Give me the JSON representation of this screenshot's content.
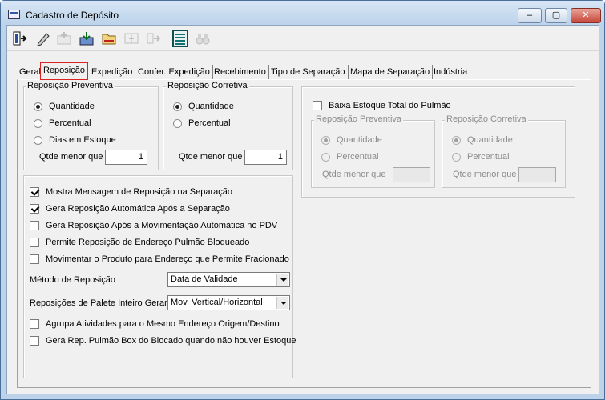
{
  "window": {
    "title": "Cadastro de Depósito",
    "minimize": "–",
    "maximize": "▢",
    "close": "✕"
  },
  "toolbar": {
    "buttons": [
      {
        "icon": "exit-icon",
        "enabled": true
      },
      {
        "icon": "edit-icon",
        "enabled": true
      },
      {
        "icon": "add-icon",
        "enabled": false
      },
      {
        "icon": "save-icon",
        "enabled": true
      },
      {
        "icon": "open-icon",
        "enabled": true
      },
      {
        "icon": "copy-icon",
        "enabled": false
      },
      {
        "icon": "transfer-icon",
        "enabled": false
      },
      {
        "icon": "report-icon",
        "enabled": true
      },
      {
        "icon": "binoculars-icon",
        "enabled": false
      }
    ]
  },
  "tabs": [
    "Geral",
    "Reposição",
    "Expedição",
    "Confer. Expedição",
    "Recebimento",
    "Tipo de Separação",
    "Mapa de Separação",
    "Indústria"
  ],
  "active_tab": "Reposição",
  "preventiva": {
    "title": "Reposição Preventiva",
    "options": [
      "Quantidade",
      "Percentual",
      "Dias em Estoque"
    ],
    "selected": "Quantidade",
    "qtde_label": "Qtde menor que",
    "qtde_value": "1"
  },
  "corretiva": {
    "title": "Reposição Corretiva",
    "options": [
      "Quantidade",
      "Percentual"
    ],
    "selected": "Quantidade",
    "qtde_label": "Qtde menor que",
    "qtde_value": "1"
  },
  "pulmao": {
    "checkbox": "Baixa Estoque Total do Pulmão",
    "checked": false,
    "preventiva": {
      "title": "Reposição Preventiva",
      "options": [
        "Quantidade",
        "Percentual"
      ],
      "selected": "Quantidade",
      "qtde_label": "Qtde menor que",
      "qtde_value": ""
    },
    "corretiva": {
      "title": "Reposição Corretiva",
      "options": [
        "Quantidade",
        "Percentual"
      ],
      "selected": "Quantidade",
      "qtde_label": "Qtde menor que",
      "qtde_value": ""
    }
  },
  "options": {
    "checks": [
      {
        "label": "Mostra Mensagem de Reposição na Separação",
        "checked": true
      },
      {
        "label": "Gera Reposição Automática Após a Separação",
        "checked": true
      },
      {
        "label": "Gera Reposição Após a Movimentação Automática no PDV",
        "checked": false
      },
      {
        "label": "Permite Reposição de Endereço Pulmão Bloqueado",
        "checked": false
      },
      {
        "label": "Movimentar o Produto para Endereço que Permite Fracionado",
        "checked": false
      }
    ],
    "metodo_label": "Método de Reposição",
    "metodo_value": "Data de Validade",
    "palete_label": "Reposições de Palete Inteiro Gerar",
    "palete_value": "Mov. Vertical/Horizontal",
    "checks_bottom": [
      {
        "label": "Agrupa Atividades para o Mesmo Endereço Origem/Destino",
        "checked": false
      },
      {
        "label": "Gera Rep. Pulmão Box do Blocado quando não houver Estoque",
        "checked": false
      }
    ]
  }
}
